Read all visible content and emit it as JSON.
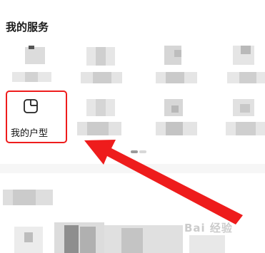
{
  "section": {
    "title": "我的服务"
  },
  "highlighted_service": {
    "label": "我的户型",
    "icon": "floorplan-icon"
  },
  "annotation": {
    "color": "#ee1c1c"
  },
  "watermark": {
    "text": "Bai 经验"
  }
}
